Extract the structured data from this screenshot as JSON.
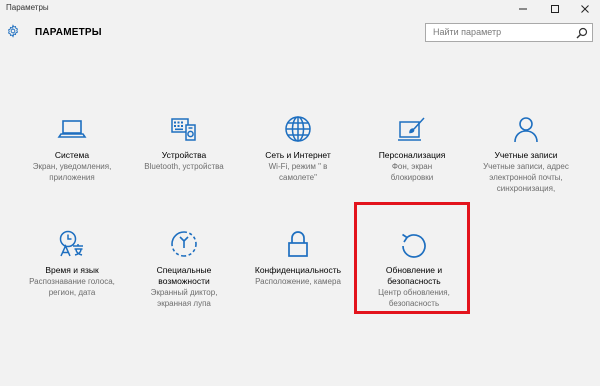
{
  "window": {
    "title": "Параметры",
    "accent_color": "#1e6fc0",
    "highlight_color": "#e3141d"
  },
  "header": {
    "title": "ПАРАМЕТРЫ",
    "icon": "gear-icon"
  },
  "search": {
    "placeholder": "Найти параметр",
    "icon": "search-icon"
  },
  "tiles": [
    {
      "name": "Система",
      "desc": [
        "Экран, уведомления,",
        "приложения"
      ],
      "icon": "laptop-icon"
    },
    {
      "name": "Устройства",
      "desc": [
        "Bluetooth, устройства"
      ],
      "icon": "devices-icon"
    },
    {
      "name": "Сеть и Интернет",
      "desc": [
        "Wi-Fi, режим \" в",
        "самолете\""
      ],
      "icon": "globe-icon"
    },
    {
      "name": "Персонализация",
      "desc": [
        "Фон, экран",
        "блокировки"
      ],
      "icon": "paint-icon"
    },
    {
      "name": "Учетные записи",
      "desc": [
        "Учетные записи, адрес",
        "электронной почты,",
        "синхронизация,"
      ],
      "icon": "person-icon"
    },
    {
      "name": "Время и язык",
      "desc": [
        "Распознавание голоса,",
        "регион, дата"
      ],
      "icon": "time-language-icon"
    },
    {
      "name": [
        "Специальные",
        "возможности"
      ],
      "desc": [
        "Экранный диктор,",
        "экранная лупа"
      ],
      "icon": "accessibility-icon"
    },
    {
      "name": "Конфиденциальность",
      "desc": [
        "Расположение, камера"
      ],
      "icon": "lock-icon"
    },
    {
      "name": [
        "Обновление и",
        "безопасность"
      ],
      "desc": [
        "Центр обновления,",
        "безопасность"
      ],
      "icon": "update-icon"
    }
  ]
}
